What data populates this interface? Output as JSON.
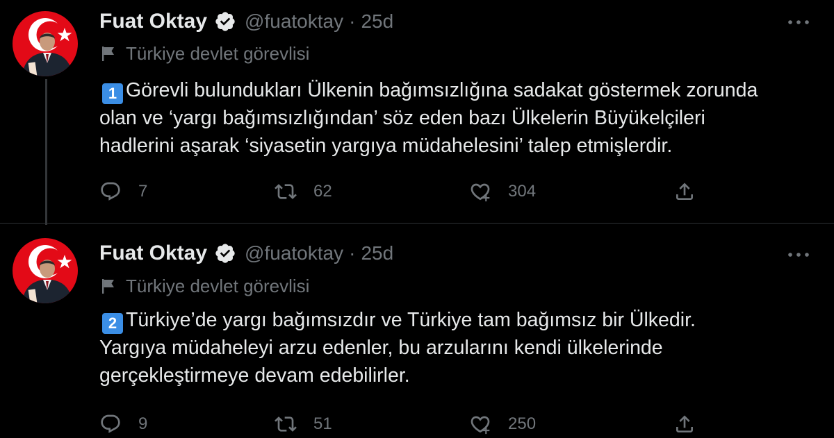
{
  "tweets": [
    {
      "author": {
        "display_name": "Fuat Oktay",
        "handle": "@fuatoktay",
        "verified": true,
        "avatar": "portrait-with-turkish-flag"
      },
      "separator": "·",
      "time": "25d",
      "label": {
        "icon": "flag-icon",
        "text": "Türkiye devlet görevlisi"
      },
      "keycap": "1",
      "body_lines": [
        "Görevli bulundukları Ülkenin bağımsızlığına sadakat göstermek zorunda",
        "olan ve ‘yargı bağımsızlığından’ söz eden bazı Ülkelerin Büyükelçileri",
        "hadlerini aşarak ‘siyasetin yargıya müdahelesini’ talep etmişlerdir."
      ],
      "counts": {
        "replies": "7",
        "retweets": "62",
        "likes": "304"
      }
    },
    {
      "author": {
        "display_name": "Fuat Oktay",
        "handle": "@fuatoktay",
        "verified": true,
        "avatar": "portrait-with-turkish-flag"
      },
      "separator": "·",
      "time": "25d",
      "label": {
        "icon": "flag-icon",
        "text": "Türkiye devlet görevlisi"
      },
      "keycap": "2",
      "body_lines": [
        "Türkiye’de yargı bağımsızdır ve Türkiye tam bağımsız bir Ülkedir.",
        "Yargıya müdaheleyi arzu edenler, bu arzularını kendi ülkelerinde",
        "gerçekleştirmeye devam edebilirler."
      ],
      "counts": {
        "replies": "9",
        "retweets": "51",
        "likes": "250"
      }
    }
  ],
  "colors": {
    "background": "#000000",
    "text_primary": "#e7e9ea",
    "text_secondary": "#71767b",
    "divider": "#2f3336",
    "keycap_blue": "#3b8ee5",
    "avatar_red": "#e30a17"
  },
  "icons": {
    "verified": "verified-badge-icon",
    "more": "more-horizontal-icon",
    "reply": "reply-icon",
    "retweet": "retweet-icon",
    "like": "like-icon",
    "share": "share-icon"
  }
}
